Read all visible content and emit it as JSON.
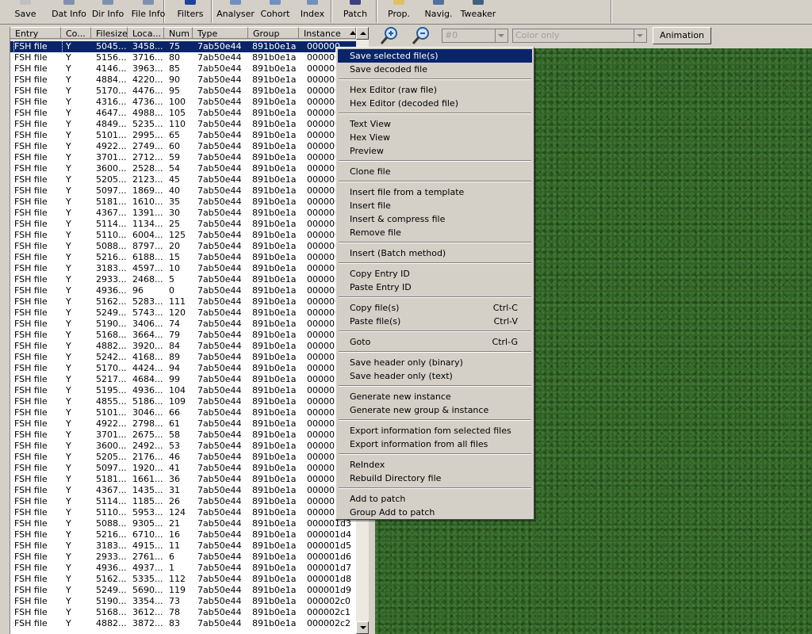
{
  "toolbar": {
    "buttons": [
      {
        "label": "Save",
        "icon": "save-icon",
        "color": "#c0c0c0"
      },
      {
        "label": "Dat Info",
        "icon": "dat-info-icon",
        "color": "#8090b0"
      },
      {
        "label": "Dir Info",
        "icon": "dir-info-icon",
        "color": "#8090b0"
      },
      {
        "label": "File Info",
        "icon": "file-info-icon",
        "color": "#8090b0"
      },
      {
        "label": "Filters",
        "icon": "filters-icon",
        "color": "#2040a0"
      },
      {
        "label": "Analyser",
        "icon": "analyser-icon",
        "color": "#7090c0"
      },
      {
        "label": "Cohort",
        "icon": "cohort-icon",
        "color": "#7090c0"
      },
      {
        "label": "Index",
        "icon": "index-icon",
        "color": "#7090c0"
      },
      {
        "label": "Patch",
        "icon": "patch-icon",
        "color": "#404080"
      },
      {
        "label": "Prop.",
        "icon": "properties-icon",
        "color": "#e0c060"
      },
      {
        "label": "Navig.",
        "icon": "navigation-icon",
        "color": "#5070a0"
      },
      {
        "label": "Tweaker",
        "icon": "tweaker-icon",
        "color": "#406080"
      }
    ]
  },
  "table": {
    "columns": [
      "Entry",
      "Co...",
      "Filesize",
      "Loca...",
      "Num",
      "Type",
      "Group",
      "Instance"
    ],
    "rows": [
      [
        "FSH file",
        "Y",
        "5045...",
        "3458...",
        "75",
        "7ab50e44",
        "891b0e1a",
        "000000"
      ],
      [
        "FSH file",
        "Y",
        "5156...",
        "3716...",
        "80",
        "7ab50e44",
        "891b0e1a",
        "000000"
      ],
      [
        "FSH file",
        "Y",
        "4146...",
        "3963...",
        "85",
        "7ab50e44",
        "891b0e1a",
        "000000"
      ],
      [
        "FSH file",
        "Y",
        "4884...",
        "4220...",
        "90",
        "7ab50e44",
        "891b0e1a",
        "000000"
      ],
      [
        "FSH file",
        "Y",
        "5170...",
        "4476...",
        "95",
        "7ab50e44",
        "891b0e1a",
        "000000"
      ],
      [
        "FSH file",
        "Y",
        "4316...",
        "4736...",
        "100",
        "7ab50e44",
        "891b0e1a",
        "000000"
      ],
      [
        "FSH file",
        "Y",
        "4647...",
        "4988...",
        "105",
        "7ab50e44",
        "891b0e1a",
        "000000"
      ],
      [
        "FSH file",
        "Y",
        "4849...",
        "5235...",
        "110",
        "7ab50e44",
        "891b0e1a",
        "000000"
      ],
      [
        "FSH file",
        "Y",
        "5101...",
        "2995...",
        "65",
        "7ab50e44",
        "891b0e1a",
        "000000"
      ],
      [
        "FSH file",
        "Y",
        "4922...",
        "2749...",
        "60",
        "7ab50e44",
        "891b0e1a",
        "000000"
      ],
      [
        "FSH file",
        "Y",
        "3701...",
        "2712...",
        "59",
        "7ab50e44",
        "891b0e1a",
        "000000"
      ],
      [
        "FSH file",
        "Y",
        "3600...",
        "2528...",
        "54",
        "7ab50e44",
        "891b0e1a",
        "000000"
      ],
      [
        "FSH file",
        "Y",
        "5205...",
        "2123...",
        "45",
        "7ab50e44",
        "891b0e1a",
        "000000"
      ],
      [
        "FSH file",
        "Y",
        "5097...",
        "1869...",
        "40",
        "7ab50e44",
        "891b0e1a",
        "000000"
      ],
      [
        "FSH file",
        "Y",
        "5181...",
        "1610...",
        "35",
        "7ab50e44",
        "891b0e1a",
        "000000"
      ],
      [
        "FSH file",
        "Y",
        "4367...",
        "1391...",
        "30",
        "7ab50e44",
        "891b0e1a",
        "000000"
      ],
      [
        "FSH file",
        "Y",
        "5114...",
        "1134...",
        "25",
        "7ab50e44",
        "891b0e1a",
        "000000"
      ],
      [
        "FSH file",
        "Y",
        "5110...",
        "6004...",
        "125",
        "7ab50e44",
        "891b0e1a",
        "000000"
      ],
      [
        "FSH file",
        "Y",
        "5088...",
        "8797...",
        "20",
        "7ab50e44",
        "891b0e1a",
        "000000"
      ],
      [
        "FSH file",
        "Y",
        "5216...",
        "6188...",
        "15",
        "7ab50e44",
        "891b0e1a",
        "000000"
      ],
      [
        "FSH file",
        "Y",
        "3183...",
        "4597...",
        "10",
        "7ab50e44",
        "891b0e1a",
        "000000"
      ],
      [
        "FSH file",
        "Y",
        "2933...",
        "2468...",
        "5",
        "7ab50e44",
        "891b0e1a",
        "000000"
      ],
      [
        "FSH file",
        "Y",
        "4936...",
        "96",
        "0",
        "7ab50e44",
        "891b0e1a",
        "000000"
      ],
      [
        "FSH file",
        "Y",
        "5162...",
        "5283...",
        "111",
        "7ab50e44",
        "891b0e1a",
        "000000"
      ],
      [
        "FSH file",
        "Y",
        "5249...",
        "5743...",
        "120",
        "7ab50e44",
        "891b0e1a",
        "000000"
      ],
      [
        "FSH file",
        "Y",
        "5190...",
        "3406...",
        "74",
        "7ab50e44",
        "891b0e1a",
        "000001"
      ],
      [
        "FSH file",
        "Y",
        "5168...",
        "3664...",
        "79",
        "7ab50e44",
        "891b0e1a",
        "000001"
      ],
      [
        "FSH file",
        "Y",
        "4882...",
        "3920...",
        "84",
        "7ab50e44",
        "891b0e1a",
        "000001"
      ],
      [
        "FSH file",
        "Y",
        "5242...",
        "4168...",
        "89",
        "7ab50e44",
        "891b0e1a",
        "000001"
      ],
      [
        "FSH file",
        "Y",
        "5170...",
        "4424...",
        "94",
        "7ab50e44",
        "891b0e1a",
        "000001"
      ],
      [
        "FSH file",
        "Y",
        "5217...",
        "4684...",
        "99",
        "7ab50e44",
        "891b0e1a",
        "000001"
      ],
      [
        "FSH file",
        "Y",
        "5195...",
        "4936...",
        "104",
        "7ab50e44",
        "891b0e1a",
        "000001"
      ],
      [
        "FSH file",
        "Y",
        "4855...",
        "5186...",
        "109",
        "7ab50e44",
        "891b0e1a",
        "000001"
      ],
      [
        "FSH file",
        "Y",
        "5101...",
        "3046...",
        "66",
        "7ab50e44",
        "891b0e1a",
        "000001"
      ],
      [
        "FSH file",
        "Y",
        "4922...",
        "2798...",
        "61",
        "7ab50e44",
        "891b0e1a",
        "000001"
      ],
      [
        "FSH file",
        "Y",
        "3701...",
        "2675...",
        "58",
        "7ab50e44",
        "891b0e1a",
        "000001"
      ],
      [
        "FSH file",
        "Y",
        "3600...",
        "2492...",
        "53",
        "7ab50e44",
        "891b0e1a",
        "000001"
      ],
      [
        "FSH file",
        "Y",
        "5205...",
        "2176...",
        "46",
        "7ab50e44",
        "891b0e1a",
        "000001"
      ],
      [
        "FSH file",
        "Y",
        "5097...",
        "1920...",
        "41",
        "7ab50e44",
        "891b0e1a",
        "000001"
      ],
      [
        "FSH file",
        "Y",
        "5181...",
        "1661...",
        "36",
        "7ab50e44",
        "891b0e1a",
        "000001"
      ],
      [
        "FSH file",
        "Y",
        "4367...",
        "1435...",
        "31",
        "7ab50e44",
        "891b0e1a",
        "000001"
      ],
      [
        "FSH file",
        "Y",
        "5114...",
        "1185...",
        "26",
        "7ab50e44",
        "891b0e1a",
        "000001"
      ],
      [
        "FSH file",
        "Y",
        "5110...",
        "5953...",
        "124",
        "7ab50e44",
        "891b0e1a",
        "000001"
      ],
      [
        "FSH file",
        "Y",
        "5088...",
        "9305...",
        "21",
        "7ab50e44",
        "891b0e1a",
        "000001d3"
      ],
      [
        "FSH file",
        "Y",
        "5216...",
        "6710...",
        "16",
        "7ab50e44",
        "891b0e1a",
        "000001d4"
      ],
      [
        "FSH file",
        "Y",
        "3183...",
        "4915...",
        "11",
        "7ab50e44",
        "891b0e1a",
        "000001d5"
      ],
      [
        "FSH file",
        "Y",
        "2933...",
        "2761...",
        "6",
        "7ab50e44",
        "891b0e1a",
        "000001d6"
      ],
      [
        "FSH file",
        "Y",
        "4936...",
        "4937...",
        "1",
        "7ab50e44",
        "891b0e1a",
        "000001d7"
      ],
      [
        "FSH file",
        "Y",
        "5162...",
        "5335...",
        "112",
        "7ab50e44",
        "891b0e1a",
        "000001d8"
      ],
      [
        "FSH file",
        "Y",
        "5249...",
        "5690...",
        "119",
        "7ab50e44",
        "891b0e1a",
        "000001d9"
      ],
      [
        "FSH file",
        "Y",
        "5190...",
        "3354...",
        "73",
        "7ab50e44",
        "891b0e1a",
        "000002c0"
      ],
      [
        "FSH file",
        "Y",
        "5168...",
        "3612...",
        "78",
        "7ab50e44",
        "891b0e1a",
        "000002c1"
      ],
      [
        "FSH file",
        "Y",
        "4882...",
        "3872...",
        "83",
        "7ab50e44",
        "891b0e1a",
        "000002c2"
      ]
    ]
  },
  "preview_toolbar": {
    "zoom_in_icon": "zoom-in-icon",
    "zoom_out_icon": "zoom-out-icon",
    "image_select_value": "#0",
    "color_mode_value": "Color only",
    "animation_label": "Animation"
  },
  "context_menu": {
    "items": [
      {
        "label": "Save selected file(s)",
        "shortcut": ""
      },
      {
        "label": "Save decoded file",
        "shortcut": ""
      },
      {
        "sep": true
      },
      {
        "label": "Hex Editor (raw file)",
        "shortcut": ""
      },
      {
        "label": "Hex Editor (decoded file)",
        "shortcut": ""
      },
      {
        "sep": true
      },
      {
        "label": "Text View",
        "shortcut": ""
      },
      {
        "label": "Hex View",
        "shortcut": ""
      },
      {
        "label": "Preview",
        "shortcut": ""
      },
      {
        "sep": true
      },
      {
        "label": "Clone file",
        "shortcut": ""
      },
      {
        "sep": true
      },
      {
        "label": "Insert file from a template",
        "shortcut": ""
      },
      {
        "label": "Insert file",
        "shortcut": ""
      },
      {
        "label": "Insert & compress file",
        "shortcut": ""
      },
      {
        "label": "Remove file",
        "shortcut": ""
      },
      {
        "sep": true
      },
      {
        "label": "Insert (Batch method)",
        "shortcut": ""
      },
      {
        "sep": true
      },
      {
        "label": "Copy Entry ID",
        "shortcut": ""
      },
      {
        "label": "Paste Entry ID",
        "shortcut": ""
      },
      {
        "sep": true
      },
      {
        "label": "Copy file(s)",
        "shortcut": "Ctrl-C"
      },
      {
        "label": "Paste file(s)",
        "shortcut": "Ctrl-V"
      },
      {
        "sep": true
      },
      {
        "label": "Goto",
        "shortcut": "Ctrl-G"
      },
      {
        "sep": true
      },
      {
        "label": "Save header only (binary)",
        "shortcut": ""
      },
      {
        "label": "Save header only (text)",
        "shortcut": ""
      },
      {
        "sep": true
      },
      {
        "label": "Generate new instance",
        "shortcut": ""
      },
      {
        "label": "Generate new group & instance",
        "shortcut": ""
      },
      {
        "sep": true
      },
      {
        "label": "Export information fom selected files",
        "shortcut": ""
      },
      {
        "label": "Export information from all files",
        "shortcut": ""
      },
      {
        "sep": true
      },
      {
        "label": "ReIndex",
        "shortcut": ""
      },
      {
        "label": "Rebuild Directory file",
        "shortcut": ""
      },
      {
        "sep": true
      },
      {
        "label": "Add to patch",
        "shortcut": ""
      },
      {
        "label": "Group Add to patch",
        "shortcut": ""
      }
    ]
  },
  "colors": {
    "selection": "#0a246a",
    "grass": "#2f6326",
    "chrome": "#d4d0c8"
  }
}
